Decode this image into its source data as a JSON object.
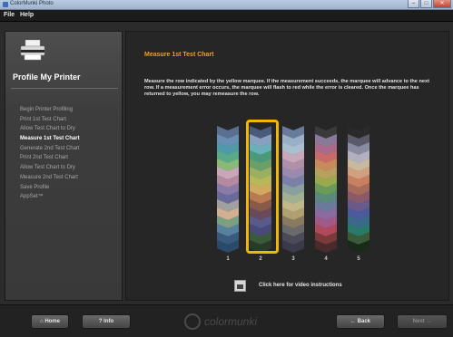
{
  "window": {
    "title": "ColorMunki Photo"
  },
  "menu": {
    "file": "File",
    "help": "Help"
  },
  "sidebar": {
    "heading": "Profile My Printer",
    "steps": [
      "Begin Printer Profiling",
      "Print 1st Test Chart",
      "Allow Test Chart to Dry",
      "Measure 1st Test Chart",
      "Generate 2nd Test Chart",
      "Print 2nd Test Chart",
      "Allow Test Chart to Dry",
      "Measure 2nd Test Chart",
      "Save Profile",
      "AppSet™"
    ],
    "active_index": 3
  },
  "main": {
    "title": "Measure 1st Test Chart",
    "instructions": "Measure the row indicated by the yellow marquee.  If the measurement succeeds, the marquee will advance to the next row.  If a measurement error occurs, the marquee will flash to red while the error is cleared.  Once the marquee has returned to yellow, you may remeasure the row.",
    "strip_labels": [
      "1",
      "2",
      "3",
      "4",
      "5"
    ],
    "selected_strip": 2,
    "video_link": "Click here for video instructions"
  },
  "chart_strips": [
    [
      "#5a6f8f",
      "#6a8fb5",
      "#4f9aa8",
      "#5aaa8a",
      "#8ab878",
      "#c9a6b8",
      "#b58aa0",
      "#8a7aa8",
      "#6a6a9a",
      "#a0a0a0",
      "#d0b090",
      "#7aa080",
      "#5a80a0",
      "#3a5a80",
      "#2a4a6a"
    ],
    [
      "#4a5a7a",
      "#8aa0c0",
      "#6ab0b8",
      "#4a9a7a",
      "#6aa068",
      "#9ab060",
      "#b8b858",
      "#d0a860",
      "#b87a50",
      "#8a5a48",
      "#6a4a5a",
      "#5a5a8a",
      "#4a4a7a",
      "#3a5a3a",
      "#2a3a2a"
    ],
    [
      "#6a7a9a",
      "#9ab0c8",
      "#a8c0d0",
      "#c8a8b8",
      "#b090a8",
      "#9a8ab0",
      "#7a80a8",
      "#8aa0a0",
      "#a0b090",
      "#c0b888",
      "#b0a070",
      "#8a7a60",
      "#6a6a6a",
      "#4a4a5a",
      "#3a3a4a"
    ],
    [
      "#3a3a3a",
      "#8a7a9a",
      "#aa6a8a",
      "#c86a6a",
      "#c88a5a",
      "#b8a060",
      "#9aa850",
      "#6a9a5a",
      "#5a8a7a",
      "#6a7a9a",
      "#8a6aa0",
      "#a05a8a",
      "#b04a5a",
      "#7a3a3a",
      "#4a2a2a"
    ],
    [
      "#2a2a2a",
      "#5a5a6a",
      "#8a8aa0",
      "#b0b0c0",
      "#c8b8a0",
      "#d0a080",
      "#c88060",
      "#a86a5a",
      "#8a5a6a",
      "#6a5a8a",
      "#4a5a9a",
      "#3a6a8a",
      "#2a7a6a",
      "#3a5a3a",
      "#1a2a1a"
    ]
  ],
  "footer": {
    "home": "Home",
    "info": "? Info",
    "brand": "colormunki",
    "back": "← Back",
    "next": "Next →"
  }
}
